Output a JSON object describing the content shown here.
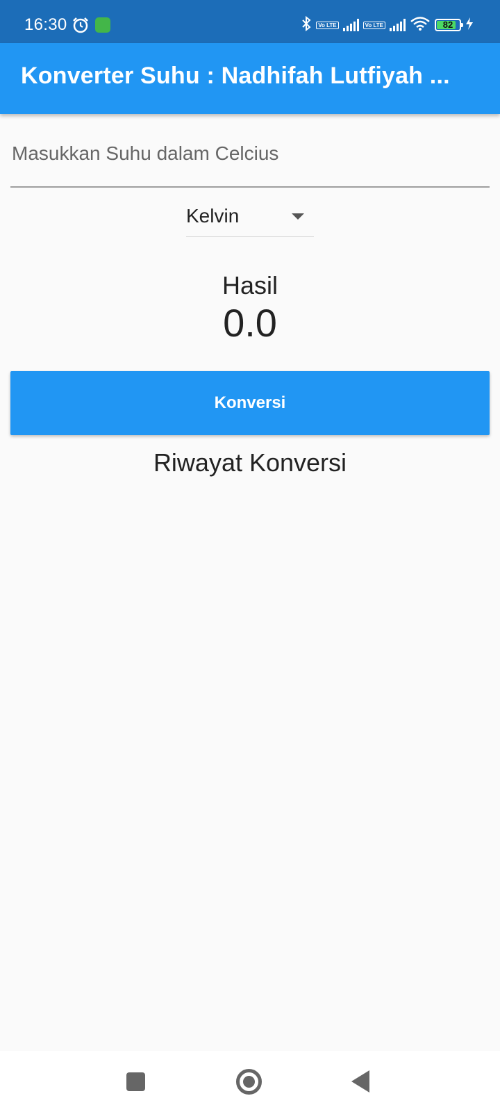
{
  "status_bar": {
    "time": "16:30",
    "battery_level": "82",
    "colors": {
      "background": "#1c6db8",
      "battery_fill": "#4cd964",
      "app_icon": "#43b649"
    },
    "icons": [
      "alarm-icon",
      "android-app-icon",
      "bluetooth-icon",
      "volte-icon",
      "signal-icon",
      "volte-icon",
      "signal-icon",
      "wifi-icon",
      "battery-icon",
      "charging-icon"
    ],
    "volte_label": "Vo LTE"
  },
  "app_bar": {
    "title": "Konverter Suhu : Nadhifah Lutfiyah ...",
    "color": "#2196f3"
  },
  "form": {
    "input_placeholder": "Masukkan Suhu dalam Celcius",
    "input_value": "",
    "dropdown_selected": "Kelvin"
  },
  "result": {
    "label": "Hasil",
    "value": "0.0"
  },
  "convert_button": {
    "label": "Konversi"
  },
  "history": {
    "title": "Riwayat Konversi",
    "items": []
  },
  "nav_bar": {
    "icons": [
      "recent-apps-icon",
      "home-icon",
      "back-icon"
    ]
  }
}
